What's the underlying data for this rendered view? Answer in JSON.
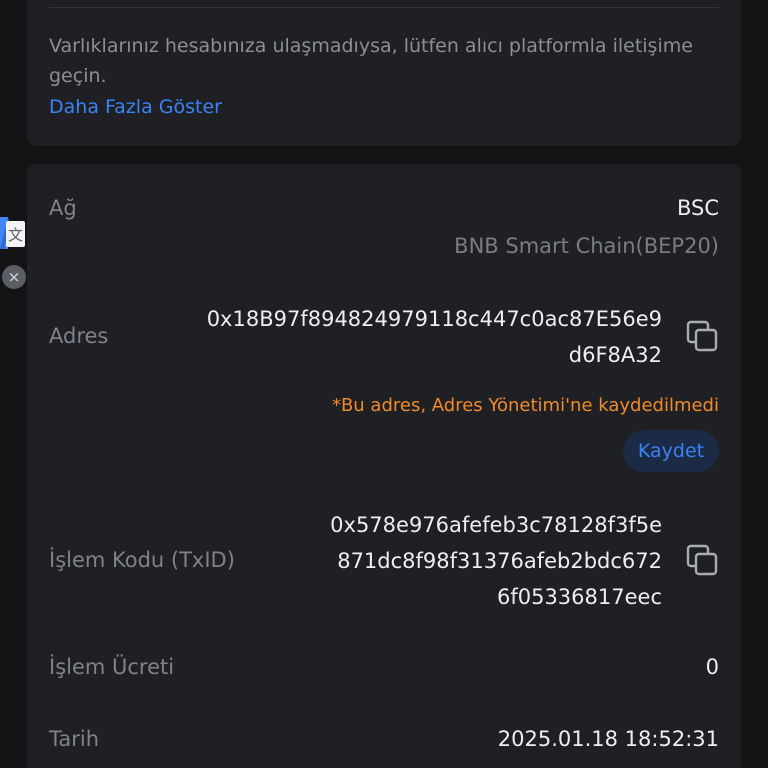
{
  "notice": {
    "text": "Varlıklarınız hesabınıza ulaşmadıysa, lütfen alıcı platformla iletişime geçin.",
    "show_more_label": "Daha Fazla Göster"
  },
  "network": {
    "label": "Ağ",
    "value": "BSC",
    "sub_value": "BNB Smart Chain(BEP20)"
  },
  "address": {
    "label": "Adres",
    "value_lines": [
      "0x18B97f894824979118c447c0ac87E56e9",
      "d6F8A32"
    ],
    "warning": "*Bu adres, Adres Yönetimi'ne kaydedilmedi",
    "save_label": "Kaydet",
    "copy_icon": "copy-icon"
  },
  "txid": {
    "label": "İşlem Kodu (TxID)",
    "value_lines": [
      "0x578e976afefeb3c78128f3f5e",
      "871dc8f98f31376afeb2bdc672",
      "6f05336817eec"
    ],
    "copy_icon": "copy-icon"
  },
  "fee": {
    "label": "İşlem Ücreti",
    "value": "0"
  },
  "date": {
    "label": "Tarih",
    "value": "2025.01.18 18:52:31"
  },
  "side_tools": {
    "translate_icon": "translate-icon",
    "close_icon": "close-icon",
    "close_glyph": "×"
  },
  "colors": {
    "background": "#141416",
    "card": "#1f2023",
    "link": "#3b82f6",
    "warning": "#f08a2c",
    "text_primary": "#eceef2",
    "text_secondary": "#7f828a"
  }
}
